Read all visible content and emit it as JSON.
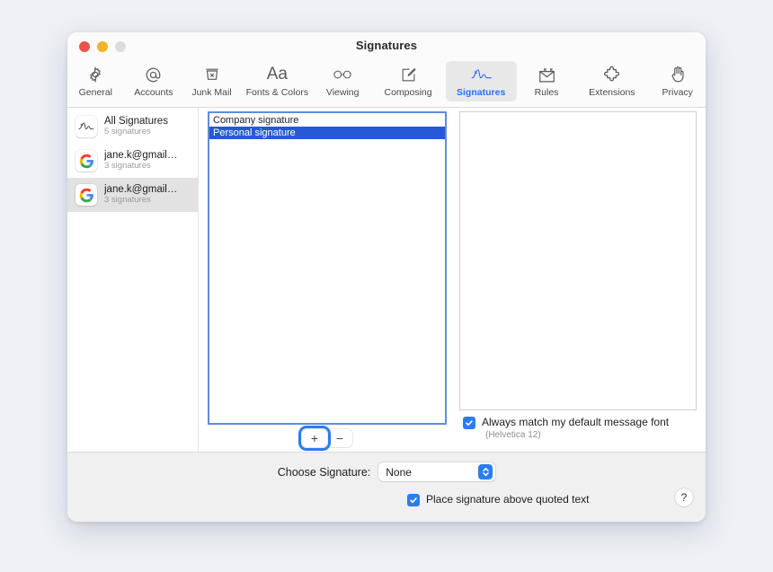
{
  "window": {
    "title": "Signatures",
    "traffic_lights": [
      "close-red",
      "minimize-yellow",
      "zoom-gray"
    ]
  },
  "toolbar": {
    "items": [
      {
        "label": "General",
        "icon": "gear-icon"
      },
      {
        "label": "Accounts",
        "icon": "at-sign-icon"
      },
      {
        "label": "Junk Mail",
        "icon": "trash-x-icon"
      },
      {
        "label": "Fonts & Colors",
        "icon": "aa-icon"
      },
      {
        "label": "Viewing",
        "icon": "glasses-icon"
      },
      {
        "label": "Composing",
        "icon": "compose-pencil-icon"
      },
      {
        "label": "Signatures",
        "icon": "signature-icon"
      },
      {
        "label": "Rules",
        "icon": "envelope-rules-icon"
      },
      {
        "label": "Extensions",
        "icon": "puzzle-piece-icon"
      },
      {
        "label": "Privacy",
        "icon": "hand-icon"
      }
    ],
    "selected_index": 6,
    "accent_color": "#2b6ff0"
  },
  "sidebar": {
    "accounts": [
      {
        "name": "All Signatures",
        "count": "5 signatures",
        "icon": "signature-icon",
        "selected": false
      },
      {
        "name": "jane.k@gmail…",
        "count": "3 signatures",
        "icon": "google-icon",
        "selected": false
      },
      {
        "name": "jane.k@gmail…",
        "count": "3 signatures",
        "icon": "google-icon",
        "selected": true
      }
    ]
  },
  "signature_list": {
    "items": [
      {
        "label": "Company signature",
        "selected": false
      },
      {
        "label": "Personal signature",
        "selected": true
      }
    ],
    "focus_color": "#5d8ddb",
    "selection_color": "#2559d8",
    "add_button_label": "+",
    "remove_button_label": "−"
  },
  "preview": {
    "content": "",
    "match_font_checkbox": {
      "label": "Always match my default message font",
      "sublabel": "(Helvetica 12)",
      "checked": true
    }
  },
  "bottom": {
    "choose_label": "Choose Signature:",
    "choose_value": "None",
    "place_above_checkbox": {
      "label": "Place signature above quoted text",
      "checked": true
    },
    "help_label": "?"
  }
}
